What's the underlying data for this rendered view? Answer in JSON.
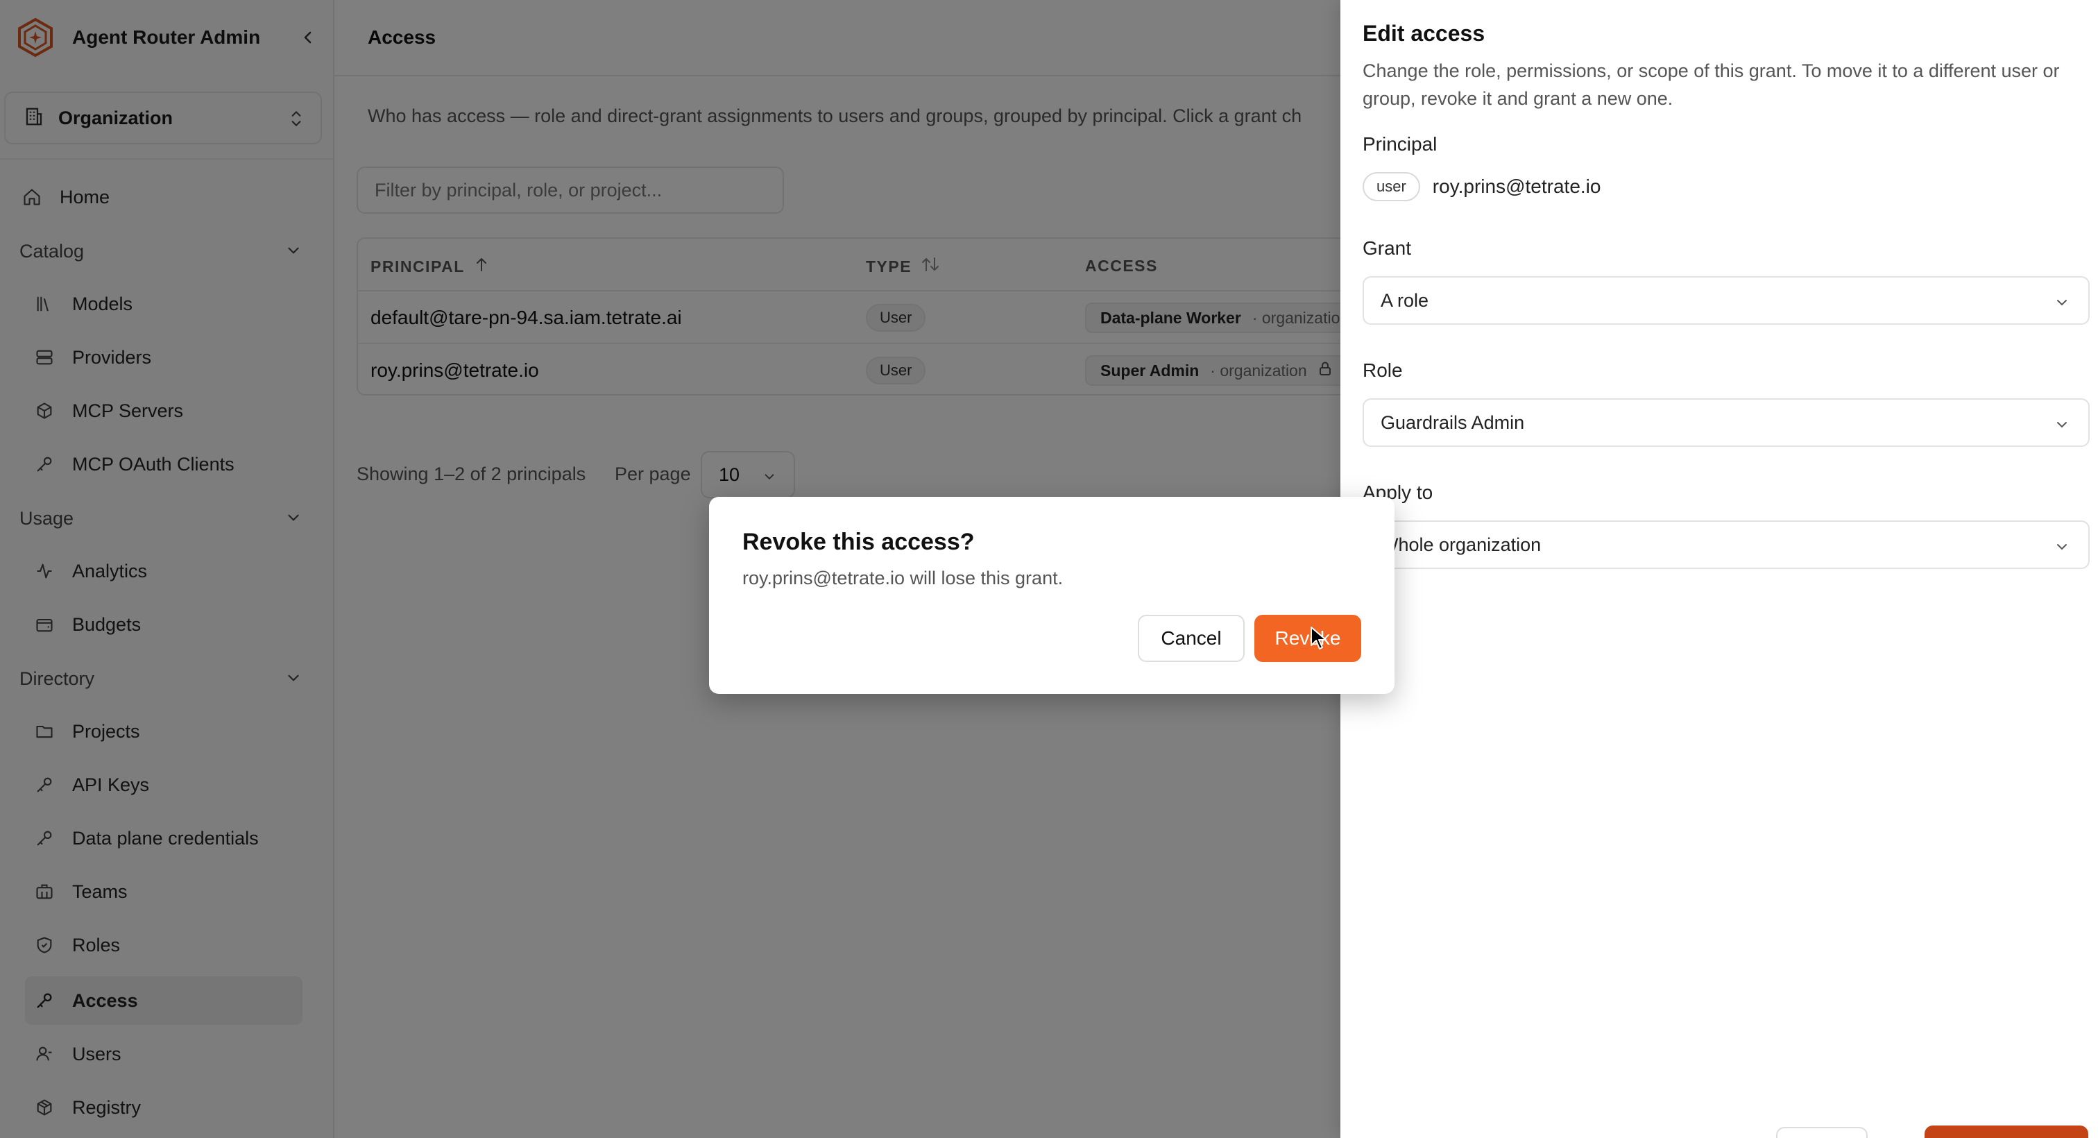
{
  "sidebar": {
    "app_title": "Agent Router Admin",
    "org_selector": "Organization",
    "home": "Home",
    "sections": {
      "catalog": "Catalog",
      "usage": "Usage",
      "directory": "Directory"
    },
    "items": {
      "models": "Models",
      "providers": "Providers",
      "mcp_servers": "MCP Servers",
      "mcp_oauth_clients": "MCP OAuth Clients",
      "analytics": "Analytics",
      "budgets": "Budgets",
      "projects": "Projects",
      "api_keys": "API Keys",
      "data_plane_credentials": "Data plane credentials",
      "teams": "Teams",
      "roles": "Roles",
      "access": "Access",
      "users": "Users",
      "registry": "Registry"
    },
    "active_item": "access"
  },
  "main": {
    "title": "Access",
    "description": "Who has access — role and direct-grant assignments to users and groups, grouped by principal. Click a grant ch",
    "filter_placeholder": "Filter by principal, role, or project...",
    "table": {
      "columns": {
        "principal": "PRINCIPAL",
        "type": "TYPE",
        "access": "ACCESS"
      },
      "rows": [
        {
          "principal": "default@tare-pn-94.sa.iam.tetrate.ai",
          "type": "User",
          "role": "Data-plane Worker",
          "scope": "· organization"
        },
        {
          "principal": "roy.prins@tetrate.io",
          "type": "User",
          "role": "Super Admin",
          "scope": "· organization"
        }
      ]
    },
    "pagination": {
      "showing": "Showing 1–2 of 2 principals",
      "per_page_label": "Per page",
      "per_page_value": "10"
    }
  },
  "panel": {
    "title": "Edit access",
    "description": "Change the role, permissions, or scope of this grant. To move it to a different user or group, revoke it and grant a new one.",
    "principal_label": "Principal",
    "principal_type": "user",
    "principal_email": "roy.prins@tetrate.io",
    "grant_label": "Grant",
    "grant_value": "A role",
    "role_label": "Role",
    "role_value": "Guardrails Admin",
    "apply_label": "Apply to",
    "apply_value": "Whole organization"
  },
  "dialog": {
    "title": "Revoke this access?",
    "body": "roy.prins@tetrate.io will lose this grant.",
    "cancel": "Cancel",
    "revoke": "Revoke"
  },
  "colors": {
    "accent": "#f26522",
    "logo": "#d9541e"
  }
}
